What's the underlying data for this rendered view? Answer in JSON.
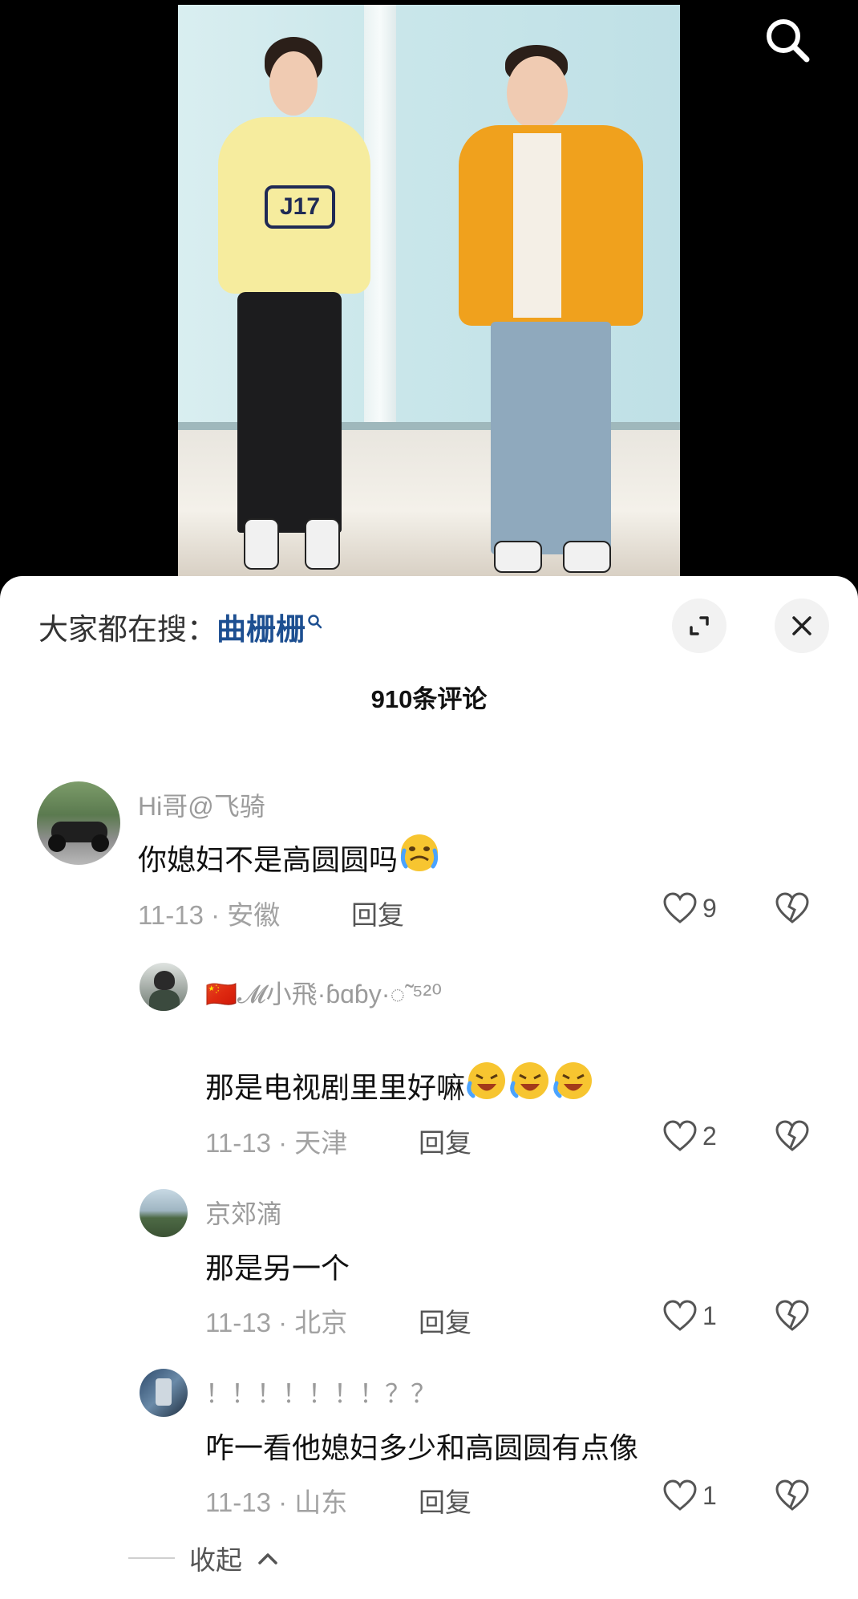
{
  "search_hint": {
    "prefix": "大家都在搜：",
    "term": "曲栅栅"
  },
  "comment_count_title": "910条评论",
  "comments": [
    {
      "user": "Hi哥@飞骑",
      "text": "你媳妇不是高圆圆吗",
      "date": "11-13",
      "location": "安徽",
      "reply_label": "回复",
      "likes": "9",
      "emoji": "crying-face"
    },
    {
      "user": "🇨🇳𝓜小飛·ɓɑɓу·◌̃ ⁵²⁰",
      "text": "那是电视剧里里好嘛",
      "date": "11-13",
      "location": "天津",
      "reply_label": "回复",
      "likes": "2",
      "emoji": "rofl-face x3"
    },
    {
      "user": "京郊滴",
      "text": "那是另一个",
      "date": "11-13",
      "location": "北京",
      "reply_label": "回复",
      "likes": "1"
    },
    {
      "user": "！！！！！！！？？",
      "text": "咋一看他媳妇多少和高圆圆有点像",
      "date": "11-13",
      "location": "山东",
      "reply_label": "回复",
      "likes": "1"
    }
  ],
  "collapse_label": "收起",
  "meta_sep": " · ",
  "colors": {
    "accent_link": "#1d4f91",
    "sheet_bg": "#ffffff",
    "page_bg": "#000000"
  },
  "icons": [
    "search-icon",
    "expand-icon",
    "close-icon",
    "heart-icon",
    "broken-heart-icon",
    "chevron-up-icon"
  ]
}
